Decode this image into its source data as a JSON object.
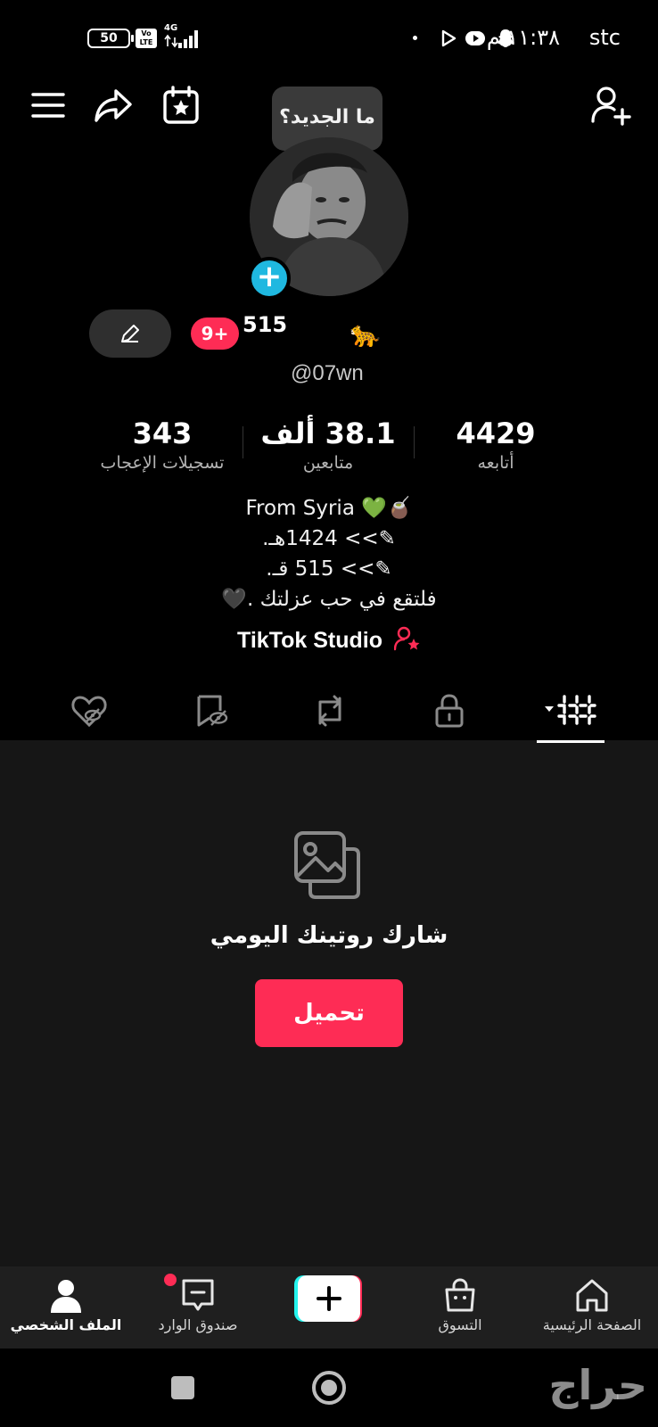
{
  "status_bar": {
    "carrier": "stc",
    "time": "١١:٣٨ م",
    "battery": "50",
    "volte": "Vo LTE",
    "network": "4G"
  },
  "header": {
    "menu_icon": "hamburger-menu-icon",
    "share_icon": "share-arrow-icon",
    "calendar_icon": "calendar-star-icon",
    "add_friend_icon": "add-friend-icon"
  },
  "tooltip": "ما الجديد؟",
  "profile": {
    "badge": "9+",
    "display_name": "515",
    "name_emoji": "🐆",
    "username": "@07wn"
  },
  "stats": [
    {
      "value": "343",
      "label": "تسجيلات الإعجاب"
    },
    {
      "value": "38.1 ألف",
      "label": "متابعين"
    },
    {
      "value": "4429",
      "label": "أتابعه"
    }
  ],
  "bio": {
    "line1": "From Syria 💚🧉",
    "line2": "✎>> 1424هـ.",
    "line3": "✎>> 515 قـ.",
    "line4": "فلتقع في حب عزلتك .🖤"
  },
  "studio_label": "TikTok Studio",
  "tabs": [
    "liked-hidden-icon",
    "favorites-hidden-icon",
    "repost-icon",
    "lock-icon",
    "grid-icon"
  ],
  "empty_state": {
    "title": "شارك روتينك اليومي",
    "upload_label": "تحميل"
  },
  "bottom_nav": {
    "profile": "الملف الشخصي",
    "inbox": "صندوق الوارد",
    "create": "+",
    "shop": "التسوق",
    "home": "الصفحة الرئيسية"
  },
  "watermark": "حراج"
}
